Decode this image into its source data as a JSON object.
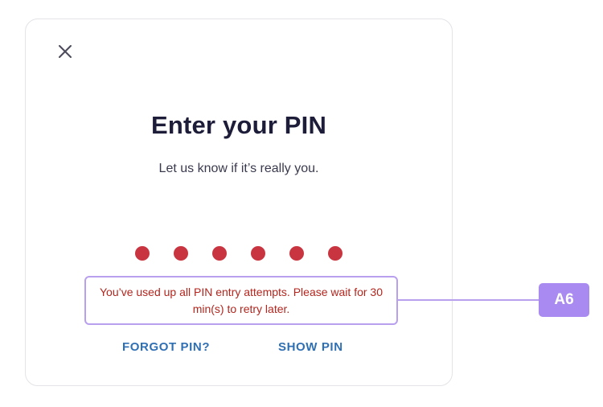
{
  "dialog": {
    "close_icon": "close-icon",
    "title": "Enter your PIN",
    "subtitle": "Let us know if it’s really you.",
    "pin_dot_count": 6,
    "pin_dot_color": "#c8343f",
    "error_message": "You’ve used up all PIN entry attempts. Please wait for 30 min(s) to retry later.",
    "error_color": "#b3261e",
    "forgot_pin_label": "FORGOT PIN?",
    "show_pin_label": "SHOW PIN",
    "link_color": "#2f6fb3"
  },
  "annotation": {
    "tag_label": "A6",
    "accent_color": "#b9a0ee",
    "tag_color": "#a98af0"
  }
}
